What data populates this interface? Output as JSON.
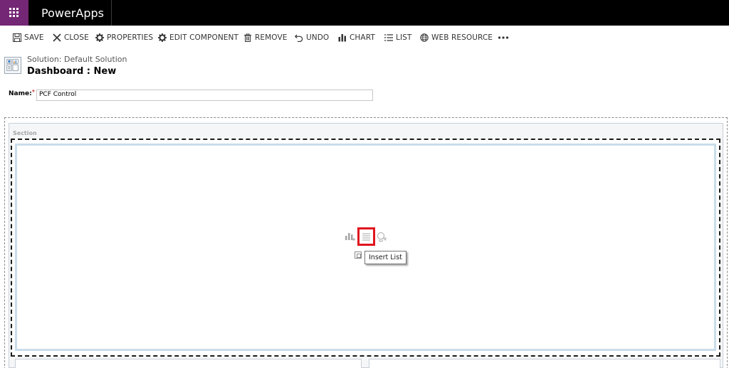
{
  "app": {
    "title": "PowerApps"
  },
  "toolbar": {
    "items": [
      {
        "label": "SAVE",
        "icon": "save-icon"
      },
      {
        "label": "CLOSE",
        "icon": "close-icon"
      },
      {
        "label": "PROPERTIES",
        "icon": "gear-icon"
      },
      {
        "label": "EDIT COMPONENT",
        "icon": "gear-icon"
      },
      {
        "label": "REMOVE",
        "icon": "trash-icon"
      },
      {
        "label": "UNDO",
        "icon": "undo-icon"
      },
      {
        "label": "CHART",
        "icon": "chart-icon"
      },
      {
        "label": "LIST",
        "icon": "list-icon"
      },
      {
        "label": "WEB RESOURCE",
        "icon": "globe-icon"
      },
      {
        "label": "",
        "icon": "more-icon"
      }
    ]
  },
  "header": {
    "solution": "Solution: Default Solution",
    "title": "Dashboard : New"
  },
  "form": {
    "name_label": "Name:",
    "required_mark": "*",
    "name_value": "PCF Control"
  },
  "canvas": {
    "section_label": "Section",
    "insert_icons": [
      "insert-chart-icon",
      "insert-list-icon",
      "insert-web-resource-icon"
    ],
    "tooltip": "Insert List",
    "highlight_color": "#e0141e"
  },
  "colors": {
    "nav_background": "#000000",
    "waffle_background": "#742774"
  }
}
